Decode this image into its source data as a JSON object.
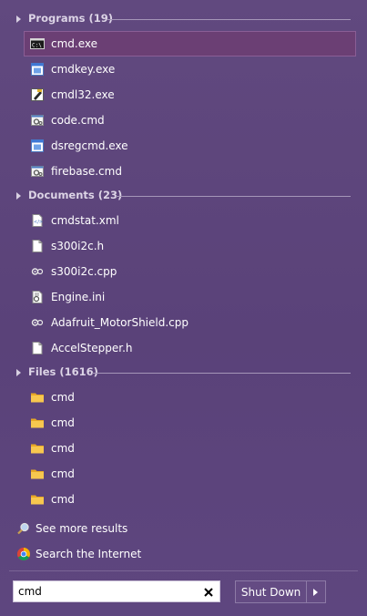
{
  "groups": {
    "programs": {
      "title": "Programs (19)",
      "items": [
        {
          "label": "cmd.exe",
          "icon": "cmd-console-icon",
          "selected": true
        },
        {
          "label": "cmdkey.exe",
          "icon": "app-window-icon"
        },
        {
          "label": "cmdl32.exe",
          "icon": "cmdl32-app-icon"
        },
        {
          "label": "code.cmd",
          "icon": "script-gear-icon"
        },
        {
          "label": "dsregcmd.exe",
          "icon": "app-window-icon"
        },
        {
          "label": "firebase.cmd",
          "icon": "script-gear-icon"
        }
      ]
    },
    "documents": {
      "title": "Documents (23)",
      "items": [
        {
          "label": "cmdstat.xml",
          "icon": "xml-file-icon"
        },
        {
          "label": "s300i2c.h",
          "icon": "blank-file-icon"
        },
        {
          "label": "s300i2c.cpp",
          "icon": "cpp-file-icon"
        },
        {
          "label": "Engine.ini",
          "icon": "settings-file-icon"
        },
        {
          "label": "Adafruit_MotorShield.cpp",
          "icon": "cpp-file-icon"
        },
        {
          "label": "AccelStepper.h",
          "icon": "blank-file-icon"
        }
      ]
    },
    "files": {
      "title": "Files (1616)",
      "items": [
        {
          "label": "cmd",
          "icon": "folder-icon"
        },
        {
          "label": "cmd",
          "icon": "folder-icon"
        },
        {
          "label": "cmd",
          "icon": "folder-icon"
        },
        {
          "label": "cmd",
          "icon": "folder-icon"
        },
        {
          "label": "cmd",
          "icon": "folder-icon"
        }
      ]
    }
  },
  "links": {
    "see_more": "See more results",
    "search_internet": "Search the Internet"
  },
  "search": {
    "value": "cmd"
  },
  "shutdown": {
    "label": "Shut Down"
  },
  "colors": {
    "background": "#5e467f",
    "selected_row": "#6b3f74",
    "folder": "#f5c24a"
  }
}
